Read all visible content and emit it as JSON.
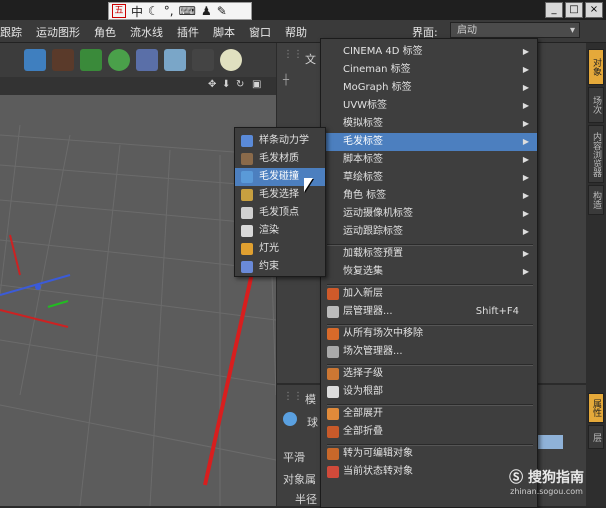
{
  "ime_bar": {
    "logo": "五",
    "mode": "中",
    "icons": [
      "moon-icon",
      "dot-comma-icon",
      "keyboard-icon",
      "person-icon",
      "wrench-icon"
    ]
  },
  "window_buttons": [
    "_",
    "□",
    "×"
  ],
  "menubar": {
    "items": [
      "跟踪",
      "运动图形",
      "角色",
      "流水线",
      "插件",
      "脚本",
      "窗口",
      "帮助"
    ],
    "layout_label": "界面:",
    "layout_value": "启动"
  },
  "viewport_nav_icons": [
    "move-view-icon",
    "down-arrow-icon",
    "rotate-view-icon",
    "maximize-view-icon"
  ],
  "panels": {
    "obj_title": "文",
    "attr_title": "模",
    "attr_object_type": "球",
    "attr_phong": "平滑",
    "attr_section": "对象属",
    "attr_radius_row": "半径"
  },
  "side_tabs": [
    "对象",
    "场次",
    "内容浏览器",
    "构造"
  ],
  "side_tabs_bottom": [
    "属性",
    "层"
  ],
  "main_menu": {
    "items": [
      {
        "label": "CINEMA 4D 标签",
        "arrow": "▶"
      },
      {
        "label": "Cineman 标签",
        "arrow": "▶"
      },
      {
        "label": "MoGraph 标签",
        "arrow": "▶"
      },
      {
        "label": "UVW标签",
        "arrow": "▶"
      },
      {
        "label": "模拟标签",
        "arrow": "▶"
      },
      {
        "label": "毛发标签",
        "arrow": "▶",
        "highlight": true
      },
      {
        "label": "脚本标签",
        "arrow": "▶"
      },
      {
        "label": "草绘标签",
        "arrow": "▶"
      },
      {
        "label": "角色 标签",
        "arrow": "▶"
      },
      {
        "label": "运动摄像机标签",
        "arrow": "▶"
      },
      {
        "label": "运动跟踪标签",
        "arrow": "▶"
      },
      {
        "label": "加载标签预置",
        "arrow": "▶"
      },
      {
        "label": "恢复选集",
        "arrow": "▶"
      },
      {
        "label": "加入新层",
        "icon": "layer-add-icon"
      },
      {
        "label": "层管理器...",
        "icon": "layer-manager-icon",
        "shortcut": "Shift+F4"
      },
      {
        "label": "从所有场次中移除",
        "icon": "take-remove-icon"
      },
      {
        "label": "场次管理器...",
        "icon": "take-manager-icon"
      },
      {
        "label": "选择子级",
        "icon": "select-children-icon"
      },
      {
        "label": "设为根部",
        "icon": "set-root-icon"
      },
      {
        "label": "全部展开",
        "icon": "expand-all-icon"
      },
      {
        "label": "全部折叠",
        "icon": "collapse-all-icon"
      },
      {
        "label": "转为可编辑对象",
        "icon": "make-editable-icon"
      },
      {
        "label": "当前状态转对象",
        "icon": "current-state-icon"
      }
    ]
  },
  "sub_menu": {
    "items": [
      {
        "label": "样条动力学",
        "icon": "spline-dynamics-icon"
      },
      {
        "label": "毛发材质",
        "icon": "hair-material-icon"
      },
      {
        "label": "毛发碰撞",
        "icon": "hair-collision-icon",
        "highlight": true
      },
      {
        "label": "毛发选择",
        "icon": "hair-selection-icon"
      },
      {
        "label": "毛发顶点",
        "icon": "hair-vertex-icon"
      },
      {
        "label": "渲染",
        "icon": "render-icon"
      },
      {
        "label": "灯光",
        "icon": "light-icon"
      },
      {
        "label": "约束",
        "icon": "constraint-icon"
      }
    ]
  },
  "watermark": {
    "title": "搜狗指南",
    "url": "zhinan.sogou.com"
  },
  "colors": {
    "highlight": "#4c7fbf",
    "arrow_annotation": "#d81e1e",
    "active_tab": "#e5a93a"
  }
}
